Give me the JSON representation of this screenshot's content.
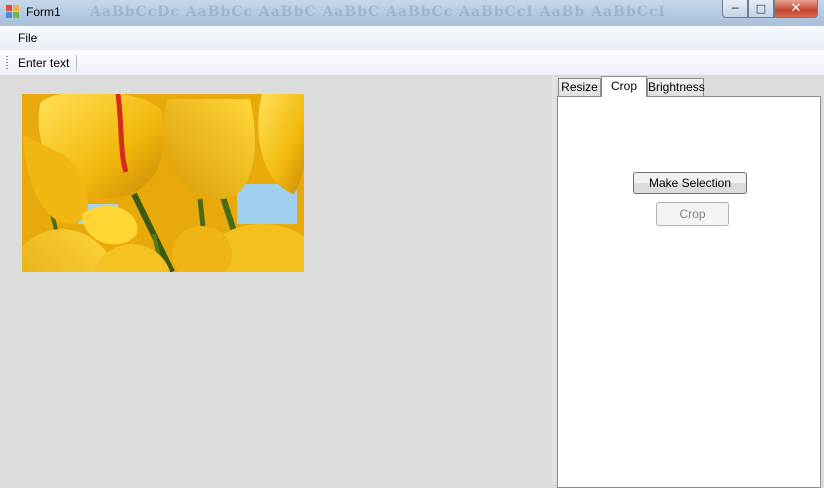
{
  "window": {
    "title": "Form1",
    "ghost_text": "AaBbCcDc  AaBbCc  AaBbC  AaBbC  AaBbCc  AaBbCcI  AaBb  AaBbCcI"
  },
  "menu": {
    "file_label": "File"
  },
  "toolstrip": {
    "enter_text_label": "Enter text"
  },
  "image": {
    "description_icon": "tulips-image"
  },
  "tabs": [
    {
      "label": "Resize"
    },
    {
      "label": "Crop"
    },
    {
      "label": "Brightness"
    }
  ],
  "crop_panel": {
    "make_selection_label": "Make Selection",
    "crop_label": "Crop"
  },
  "colors": {
    "background": "#dcdcdc",
    "panel": "#ffffff",
    "titlebar": "#b4c9e0",
    "close": "#c7442a"
  }
}
